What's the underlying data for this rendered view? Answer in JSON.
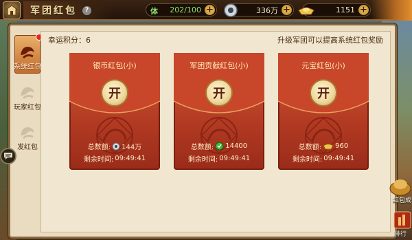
{
  "header": {
    "title": "军团红包",
    "help_label": "?",
    "stamina_label": "体",
    "stamina_value": "202/100",
    "silver_value": "336万",
    "gold_value": "1151",
    "plus_label": "+"
  },
  "info": {
    "lucky_points": "幸运积分：6",
    "tip": "升级军团可以提高系统红包奖励"
  },
  "tabs": [
    {
      "label": "系统红包",
      "active": true
    },
    {
      "label": "玩家红包",
      "active": false
    },
    {
      "label": "发红包",
      "active": false
    }
  ],
  "cards": [
    {
      "title": "银币红包(小)",
      "open_label": "开",
      "total_label": "总数额:",
      "total_value": "144万",
      "currency_icon": "silver-coin-icon",
      "time_label": "剩余时间:",
      "time_value": "09:49:41"
    },
    {
      "title": "军团贡献红包(小)",
      "open_label": "开",
      "total_label": "总数额:",
      "total_value": "14400",
      "currency_icon": "contribution-icon",
      "time_label": "剩余时间:",
      "time_value": "09:49:41"
    },
    {
      "title": "元宝红包(小)",
      "open_label": "开",
      "total_label": "总数额:",
      "total_value": "960",
      "currency_icon": "gold-ingot-icon",
      "time_label": "剩余时间:",
      "time_value": "09:49:41"
    }
  ],
  "side": {
    "red_packet_label": "红包成",
    "ranking_label": "排行"
  },
  "colors": {
    "card_red": "#b23a22",
    "panel_bg": "#f1e6cf",
    "tab_active": "#c46c2c",
    "stamina_green": "#8be06a"
  }
}
